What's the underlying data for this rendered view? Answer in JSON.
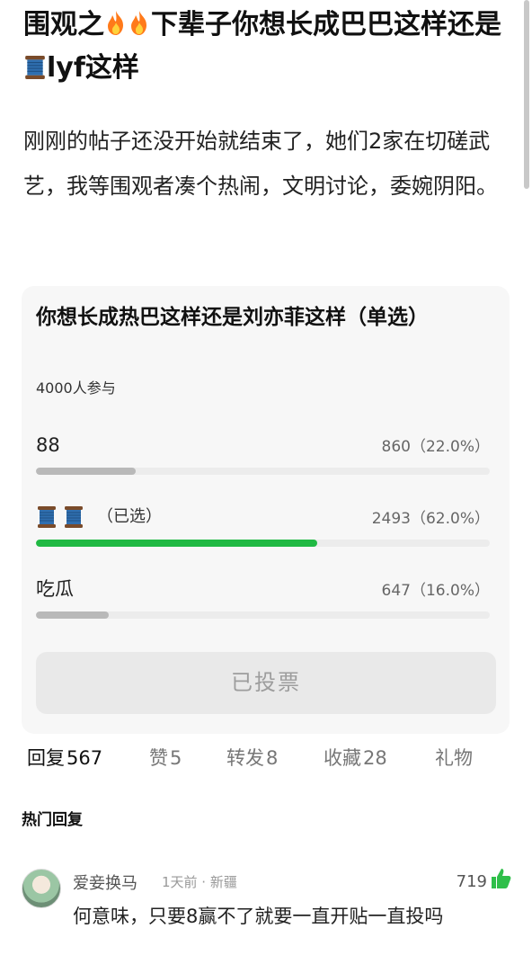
{
  "post": {
    "title_part1": "围观之",
    "title_part2": "下辈子你想长成巴巴这样还是",
    "title_part3": "lyf这样",
    "body": "刚刚的帖子还没开始就结束了，她们2家在切磋武艺，我等围观者凑个热闹，文明讨论，委婉阴阳。"
  },
  "poll": {
    "title": "你想长成热巴这样还是刘亦菲这样（单选）",
    "participants": "4000人参与",
    "options": [
      {
        "label": "88",
        "stat": "860（22.0%）",
        "fraction": 0.22,
        "selected": false
      },
      {
        "label": "",
        "stat": "2493（62.0%）",
        "fraction": 0.62,
        "selected": true,
        "selected_tag": "（已选）"
      },
      {
        "label": "吃瓜",
        "stat": "647（16.0%）",
        "fraction": 0.16,
        "selected": false
      }
    ],
    "vote_button": "已投票",
    "selected_color": "#20b943",
    "unselected_color": "#b9b9b9"
  },
  "tabs": [
    {
      "label": "回复",
      "count": "567"
    },
    {
      "label": "赞",
      "count": "5"
    },
    {
      "label": "转发",
      "count": "8"
    },
    {
      "label": "收藏",
      "count": "28"
    },
    {
      "label": "礼物",
      "count": ""
    }
  ],
  "hot_replies_label": "热门回复",
  "comment": {
    "username": "爱妾换马",
    "meta": "1天前 · 新疆",
    "likes": "719",
    "text": "何意味，只要8赢不了就要一直开贴一直投吗"
  },
  "icons": {
    "fire": "fire-icon",
    "spool": "thread-spool-icon",
    "thumb": "thumbs-up-icon"
  }
}
